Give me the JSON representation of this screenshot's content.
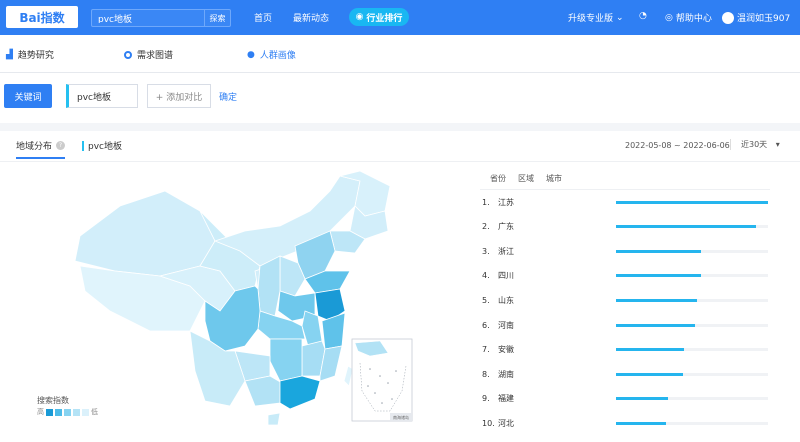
{
  "header": {
    "logo": "Bai指数",
    "search_value": "pvc地板",
    "search_button": "探索",
    "nav": [
      "首页",
      "最新动态"
    ],
    "pill": "行业排行",
    "upgrade": "升级专业版",
    "help": "帮助中心",
    "user": "温润如玉907"
  },
  "subnav": {
    "items": [
      "趋势研究",
      "需求图谱",
      "人群画像"
    ]
  },
  "keyword_bar": {
    "label": "关键词",
    "keyword": "pvc地板",
    "add": "+ 添加对比",
    "confirm": "确定"
  },
  "panel": {
    "tab": "地域分布",
    "series": "pvc地板",
    "date_range": "2022-05-08 ~ 2022-06-06",
    "period": "近30天",
    "legend_title": "搜索指数",
    "legend_high": "高",
    "legend_low": "低",
    "inset_label": "南海诸岛",
    "legend_colors": [
      "#1a9ad6",
      "#4dbbe8",
      "#86d3f1",
      "#b4e3f6",
      "#dbf1fb"
    ]
  },
  "ranking": {
    "tabs": [
      "省份",
      "区域",
      "城市"
    ],
    "rows": [
      {
        "rank": "1.",
        "name": "江苏",
        "value": 1.0
      },
      {
        "rank": "2.",
        "name": "广东",
        "value": 0.92
      },
      {
        "rank": "3.",
        "name": "浙江",
        "value": 0.56
      },
      {
        "rank": "4.",
        "name": "四川",
        "value": 0.56
      },
      {
        "rank": "5.",
        "name": "山东",
        "value": 0.53
      },
      {
        "rank": "6.",
        "name": "河南",
        "value": 0.52
      },
      {
        "rank": "7.",
        "name": "安徽",
        "value": 0.45
      },
      {
        "rank": "8.",
        "name": "湖南",
        "value": 0.44
      },
      {
        "rank": "9.",
        "name": "福建",
        "value": 0.34
      },
      {
        "rank": "10.",
        "name": "河北",
        "value": 0.33
      }
    ]
  }
}
